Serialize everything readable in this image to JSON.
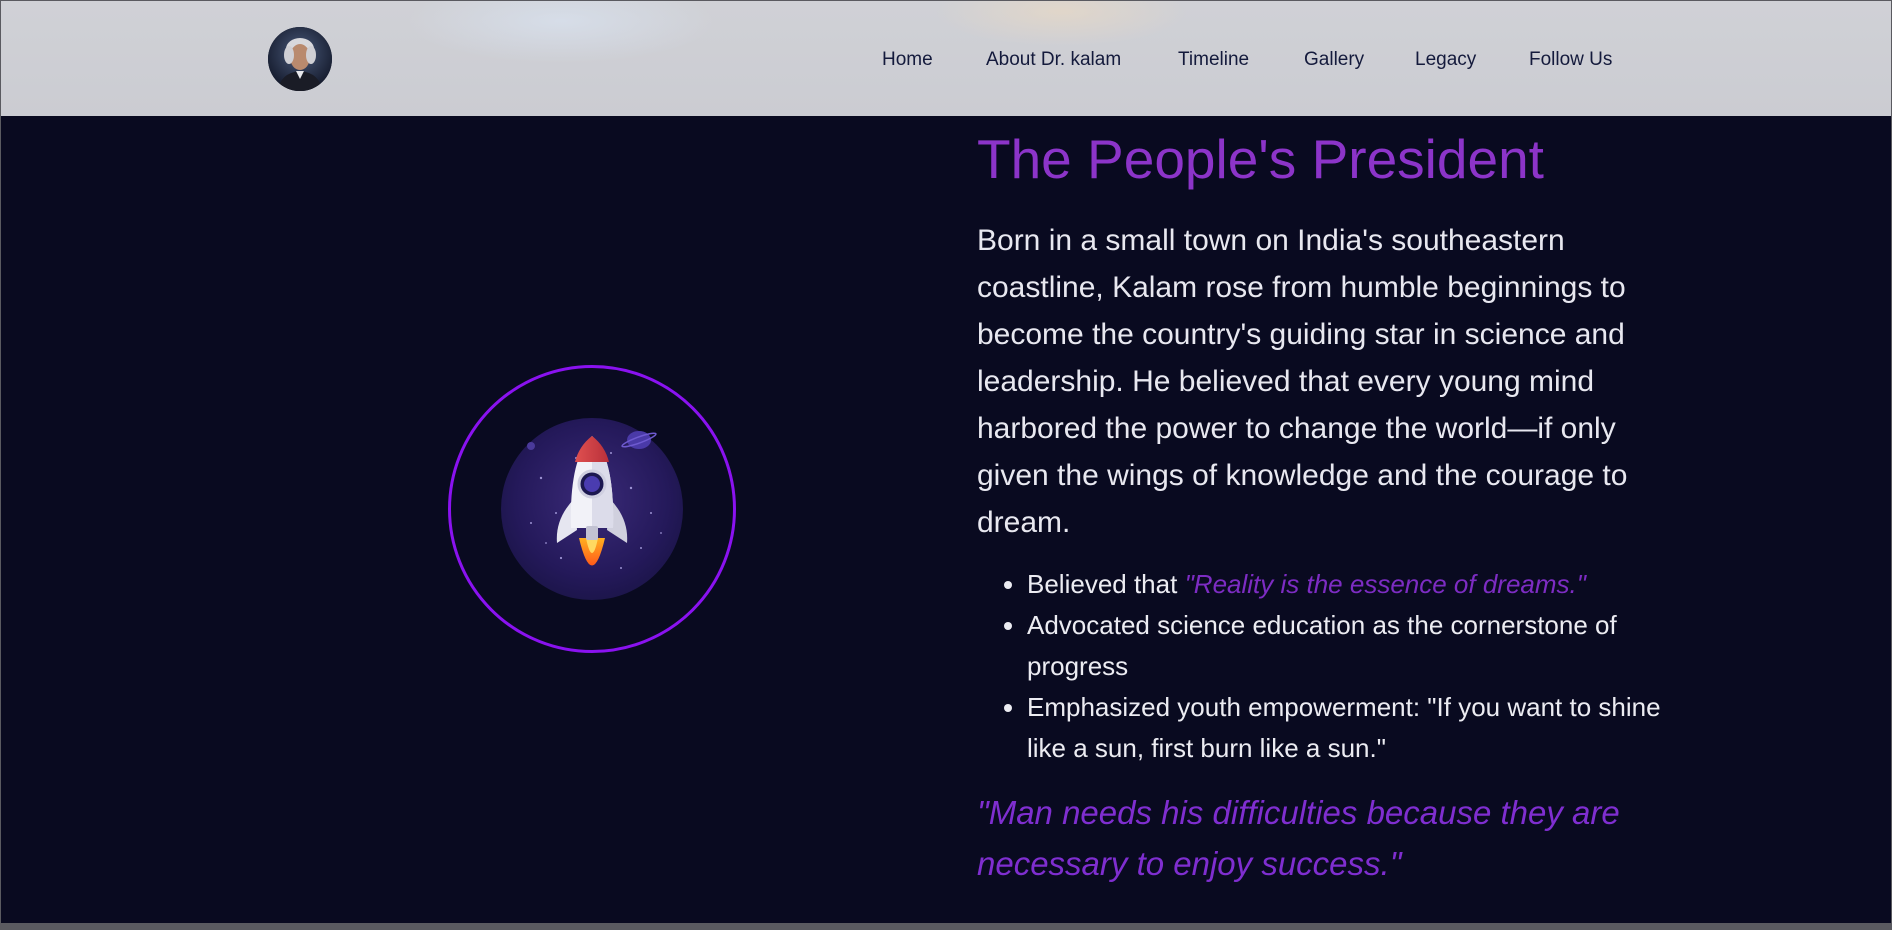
{
  "header": {
    "nav": [
      {
        "label": "Home"
      },
      {
        "label": "About Dr. kalam"
      },
      {
        "label": "Timeline"
      },
      {
        "label": "Gallery"
      },
      {
        "label": "Legacy"
      },
      {
        "label": "Follow Us"
      }
    ]
  },
  "hero": {
    "image_icon": "rocket-icon",
    "title": "The People's President",
    "body": "Born in a small town on India's southeastern coastline, Kalam rose from humble beginnings to become the country's guiding star in science and leadership. He believed that every young mind harbored the power to change the world—if only given the wings of knowledge and the courage to dream.",
    "bullets": [
      {
        "text": "Believed that ",
        "quote": "\"Reality is the essence of dreams.\""
      },
      {
        "text": "Advocated science education as the cornerstone of progress"
      },
      {
        "text": "Emphasized youth empowerment: \"If you want to shine like a sun, first burn like a sun.\""
      }
    ],
    "closing_quote": "\"Man needs his difficulties because they are necessary to enjoy success.\""
  },
  "colors": {
    "accent": "#8a12f0",
    "title": "#8c34c9",
    "background": "#090a20",
    "header": "#cbccd2"
  }
}
